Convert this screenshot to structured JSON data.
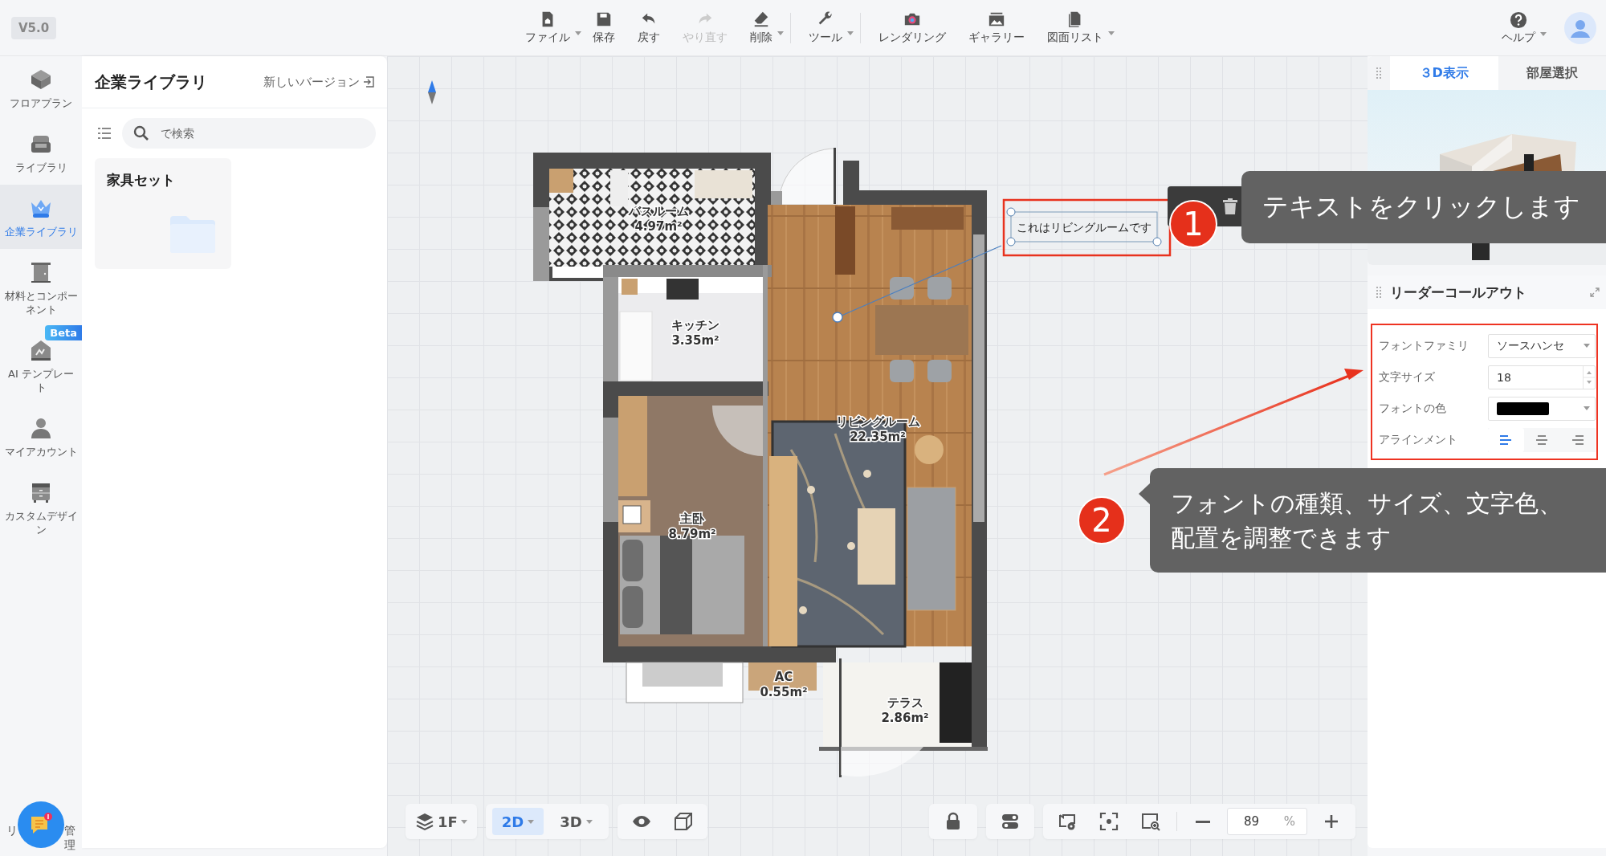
{
  "top_bar": {
    "version": "V5.0",
    "tool_groups": [
      [
        {
          "label": "ファイル",
          "has_menu": true,
          "disabled": false
        },
        {
          "label": "保存",
          "has_menu": false,
          "disabled": false
        },
        {
          "label": "戻す",
          "has_menu": false,
          "disabled": false
        },
        {
          "label": "やり直す",
          "has_menu": false,
          "disabled": true
        },
        {
          "label": "削除",
          "has_menu": true,
          "disabled": false
        }
      ],
      [
        {
          "label": "ツール",
          "has_menu": true,
          "disabled": false
        }
      ],
      [
        {
          "label": "レンダリング",
          "has_menu": false,
          "disabled": false
        },
        {
          "label": "ギャラリー",
          "has_menu": false,
          "disabled": false
        },
        {
          "label": "図面リスト",
          "has_menu": true,
          "disabled": false
        }
      ]
    ],
    "help": {
      "label": "ヘルプ"
    }
  },
  "nav": {
    "items": [
      {
        "label": "フロアプラン",
        "selected": false
      },
      {
        "label": "ライブラリ",
        "selected": false
      },
      {
        "label": "企業ライブラリ",
        "selected": true
      },
      {
        "label": "材料とコンポーネント",
        "selected": false
      },
      {
        "label": "AI テンプレート",
        "selected": false,
        "badge": "Beta"
      },
      {
        "label": "マイアカウント",
        "selected": false
      },
      {
        "label": "カスタムデザイン",
        "selected": false
      }
    ],
    "bottom_label_parts": [
      "リ",
      "管理"
    ]
  },
  "library": {
    "title": "企業ライブラリ",
    "link": "新しいバージョン",
    "search": {
      "placeholder": "で検索"
    },
    "cards": [
      {
        "title": "家具セット"
      }
    ]
  },
  "plan": {
    "rooms": [
      {
        "name": "バスルーム",
        "area": "4.97m²"
      },
      {
        "name": "キッチン",
        "area": "3.35m²"
      },
      {
        "name": "リビングルーム",
        "area": "22.35m²"
      },
      {
        "name": "主卧",
        "area": "8.79m²"
      },
      {
        "name": "AC",
        "area": "0.55m²"
      },
      {
        "name": "テラス",
        "area": "2.86m²"
      }
    ],
    "callout": {
      "text": "これはリビングルームです"
    }
  },
  "steps": [
    {
      "number": "1",
      "lines": [
        "テキストをクリックします"
      ]
    },
    {
      "number": "2",
      "lines": [
        "フォントの種類、サイズ、文字色、",
        "配置を調整できます"
      ]
    }
  ],
  "right_panel": {
    "tabs": [
      {
        "label": "３D表示",
        "selected": true
      },
      {
        "label": "部屋選択",
        "selected": false
      }
    ],
    "properties": {
      "title": "リーダーコールアウト",
      "fields": [
        {
          "kind": "select",
          "label": "フォントファミリ",
          "value": "ソースハンセ"
        },
        {
          "kind": "number",
          "label": "文字サイズ",
          "value": "18"
        },
        {
          "kind": "color",
          "label": "フォントの色",
          "color": "#000000"
        },
        {
          "kind": "align",
          "label": "アラインメント",
          "options": [
            {
              "selected": true
            },
            {
              "selected": false
            },
            {
              "selected": false
            }
          ]
        }
      ]
    }
  },
  "bottom_bar": {
    "floor": "1F",
    "views": [
      {
        "label": "2D",
        "selected": true
      },
      {
        "label": "3D",
        "selected": false
      }
    ],
    "zoom": {
      "value": "89",
      "unit": "%"
    }
  }
}
